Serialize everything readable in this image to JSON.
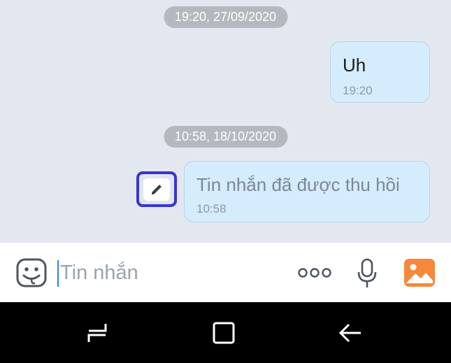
{
  "conversation": {
    "sections": [
      {
        "date_label": "19:20, 27/09/2020",
        "message": {
          "text": "Uh",
          "time": "19:20"
        }
      },
      {
        "date_label": "10:58, 18/10/2020",
        "message": {
          "text": "Tin nhắn đã được thu hồi",
          "time": "10:58",
          "recalled": true
        }
      }
    ]
  },
  "composer": {
    "placeholder": "Tin nhắn",
    "value": "",
    "icons": [
      "sticker-icon",
      "more-icon",
      "microphone-icon",
      "photo-icon"
    ]
  },
  "nav": {
    "buttons": [
      "recent-apps-icon",
      "home-icon",
      "back-icon"
    ]
  },
  "colors": {
    "chat_bg": "#e3e8f0",
    "bubble_bg": "#d4ecfb",
    "accent": "#3a35d0",
    "photo_icon": "#f5883a"
  }
}
